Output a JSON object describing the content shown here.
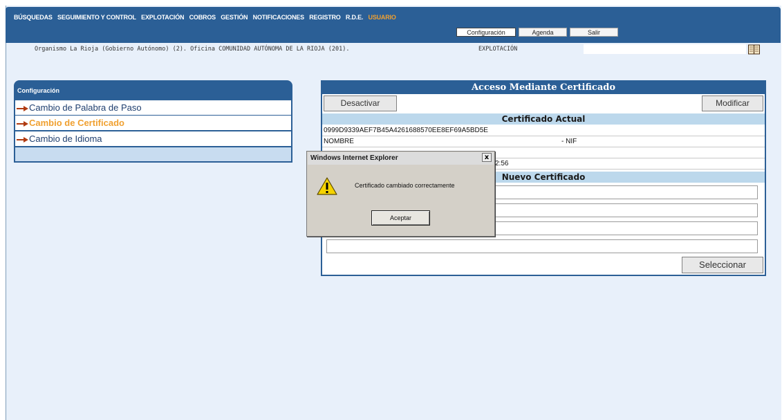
{
  "menu": {
    "items": [
      "BÚSQUEDAS",
      "SEGUIMIENTO Y CONTROL",
      "EXPLOTACIÓN",
      "COBROS",
      "GESTIÓN",
      "NOTIFICACIONES",
      "REGISTRO",
      "R.D.E.",
      "USUARIO"
    ],
    "active": "USUARIO"
  },
  "subnav": {
    "configuracion": "Configuración",
    "agenda": "Agenda",
    "salir": "Salir"
  },
  "info": {
    "organismo": "Organismo La Rioja (Gobierno Autónomo) (2). Oficina COMUNIDAD AUTÓNOMA DE LA RIOJA (201).",
    "modo": "EXPLOTACIÓN"
  },
  "config": {
    "title": "Configuración",
    "items": [
      {
        "label": "Cambio de Palabra de Paso"
      },
      {
        "label": "Cambio de Certificado"
      },
      {
        "label": "Cambio de Idioma"
      }
    ]
  },
  "cert": {
    "title": "Acceso Mediante Certificado",
    "desactivar": "Desactivar",
    "modificar": "Modificar",
    "actual_header": "Certificado Actual",
    "serial": "0999D9339AEF7B45A4261688570EE8EF69A5BD5E",
    "nombre": "NOMBRE",
    "nif": "- NIF",
    "date_partial": "2:56",
    "nuevo_header": "Nuevo Certificado",
    "seleccionar": "Seleccionar"
  },
  "dialog": {
    "title": "Windows Internet Explorer",
    "close": "x",
    "message": "Certificado cambiado correctamente",
    "ok": "Aceptar"
  },
  "colors": {
    "brand_blue": "#2b5f96",
    "active_orange": "#f0a030",
    "background": "#e8f0fa"
  }
}
